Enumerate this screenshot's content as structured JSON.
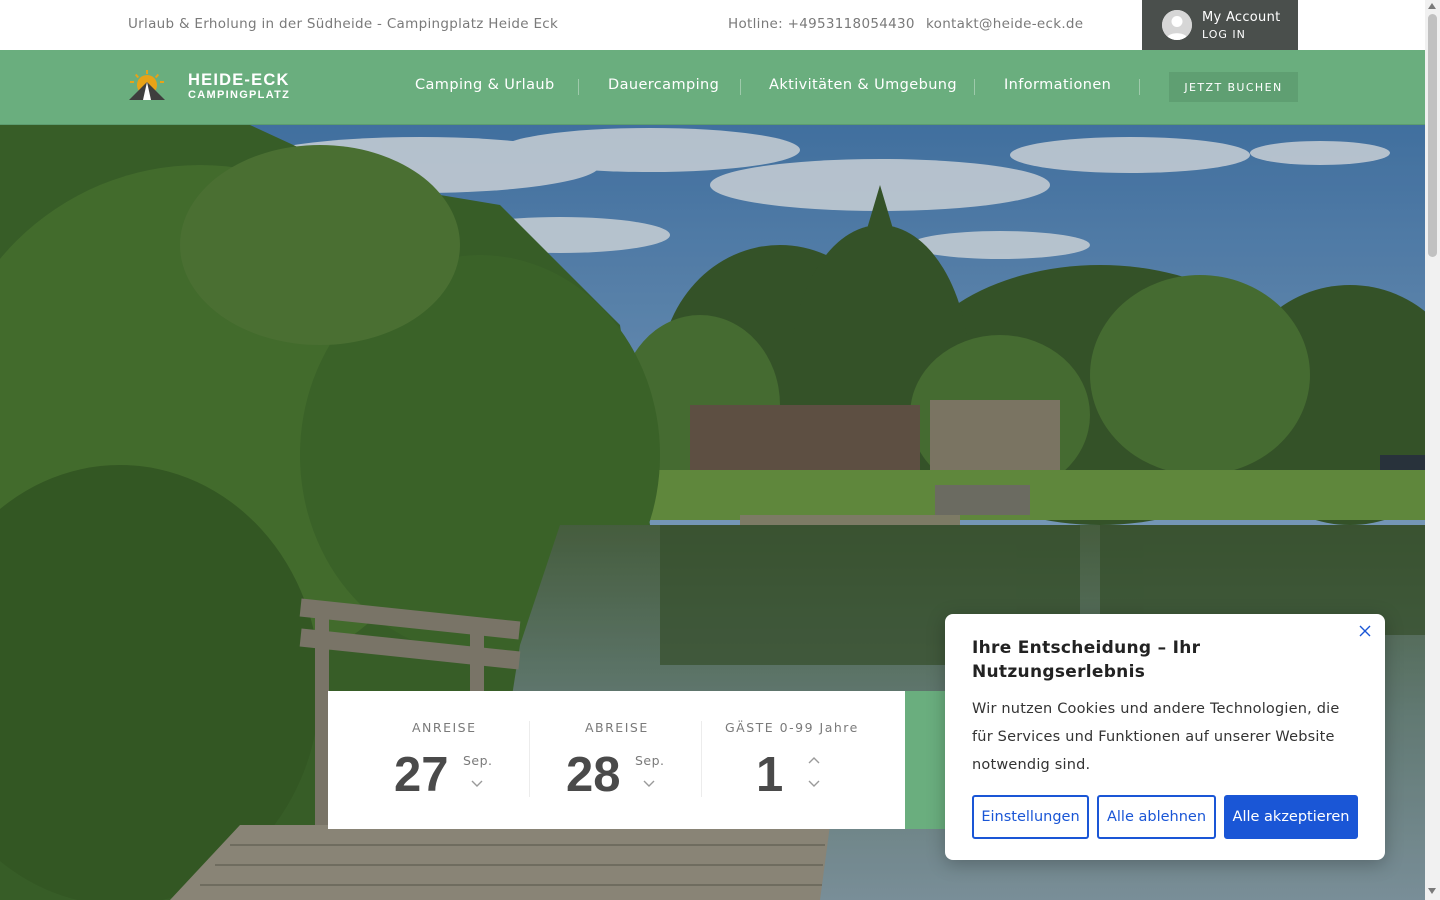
{
  "topbar": {
    "tagline": "Urlaub & Erholung in der Südheide - Campingplatz Heide Eck",
    "hotline": "Hotline: +4953118054430",
    "email": "kontakt@heide-eck.de",
    "account_title": "My Account",
    "account_login": "LOG IN"
  },
  "logo": {
    "line1": "HEIDE-ECK",
    "line2": "CAMPINGPLATZ"
  },
  "nav": {
    "items": [
      "Camping & Urlaub",
      "Dauercamping",
      "Aktivitäten & Umgebung",
      "Informationen"
    ],
    "book_label": "JETZT BUCHEN"
  },
  "booking": {
    "arrival": {
      "label": "ANREISE",
      "day": "27",
      "month": "Sep."
    },
    "departure": {
      "label": "ABREISE",
      "day": "28",
      "month": "Sep."
    },
    "guests": {
      "label": "GÄSTE 0-99 Jahre",
      "count": "1"
    }
  },
  "cookie": {
    "title": "Ihre Entscheidung – Ihr Nutzungserlebnis",
    "text": "Wir nutzen Cookies und andere Technologien, die für Services und Funktionen auf unserer Website notwendig sind.",
    "settings_label": "Einstellungen",
    "reject_label": "Alle ablehnen",
    "accept_label": "Alle akzeptieren"
  },
  "icons": {
    "avatar": "user-avatar-icon",
    "close": "close-icon",
    "chevron": "chevron-down-icon"
  },
  "colors": {
    "nav_green": "#6aae7e",
    "account_bg": "#4a4f4c",
    "cookie_blue": "#1a56d6",
    "logo_sun": "#e8a317"
  }
}
